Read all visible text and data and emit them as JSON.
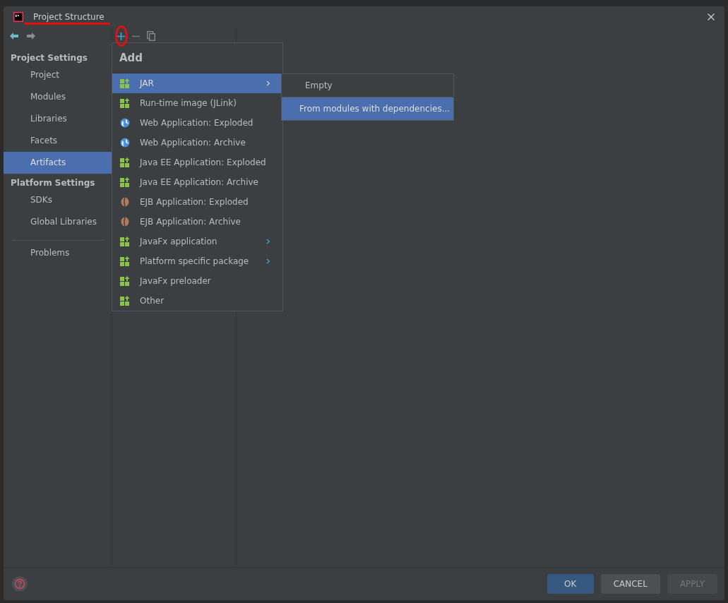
{
  "window": {
    "title": "Project Structure"
  },
  "sidebar": {
    "sections": [
      {
        "title": "Project Settings",
        "items": [
          {
            "label": "Project",
            "selected": false
          },
          {
            "label": "Modules",
            "selected": false
          },
          {
            "label": "Libraries",
            "selected": false
          },
          {
            "label": "Facets",
            "selected": false
          },
          {
            "label": "Artifacts",
            "selected": true
          }
        ]
      },
      {
        "title": "Platform Settings",
        "items": [
          {
            "label": "SDKs",
            "selected": false
          },
          {
            "label": "Global Libraries",
            "selected": false
          }
        ]
      },
      {
        "items": [
          {
            "label": "Problems",
            "selected": false
          }
        ]
      }
    ]
  },
  "add_menu": {
    "title": "Add",
    "items": [
      {
        "label": "JAR",
        "kind": "module",
        "submenu": true,
        "selected": true
      },
      {
        "label": "Run-time image (JLink)",
        "kind": "module",
        "submenu": false,
        "selected": false
      },
      {
        "label": "Web Application: Exploded",
        "kind": "web",
        "submenu": false,
        "selected": false
      },
      {
        "label": "Web Application: Archive",
        "kind": "web",
        "submenu": false,
        "selected": false
      },
      {
        "label": "Java EE Application: Exploded",
        "kind": "module",
        "submenu": false,
        "selected": false
      },
      {
        "label": "Java EE Application: Archive",
        "kind": "module",
        "submenu": false,
        "selected": false
      },
      {
        "label": "EJB Application: Exploded",
        "kind": "ejb",
        "submenu": false,
        "selected": false
      },
      {
        "label": "EJB Application: Archive",
        "kind": "ejb",
        "submenu": false,
        "selected": false
      },
      {
        "label": "JavaFx application",
        "kind": "module",
        "submenu": true,
        "selected": false
      },
      {
        "label": "Platform specific package",
        "kind": "module",
        "submenu": true,
        "selected": false
      },
      {
        "label": "JavaFx preloader",
        "kind": "module",
        "submenu": false,
        "selected": false
      },
      {
        "label": "Other",
        "kind": "module",
        "submenu": false,
        "selected": false
      }
    ]
  },
  "jar_submenu": {
    "items": [
      {
        "label": "Empty",
        "selected": false
      },
      {
        "label": "From modules with dependencies...",
        "selected": true
      }
    ]
  },
  "buttons": [
    {
      "label": "OK",
      "kind": "primary",
      "disabled": false
    },
    {
      "label": "CANCEL",
      "kind": "normal",
      "disabled": false
    },
    {
      "label": "APPLY",
      "kind": "normal",
      "disabled": true
    }
  ]
}
